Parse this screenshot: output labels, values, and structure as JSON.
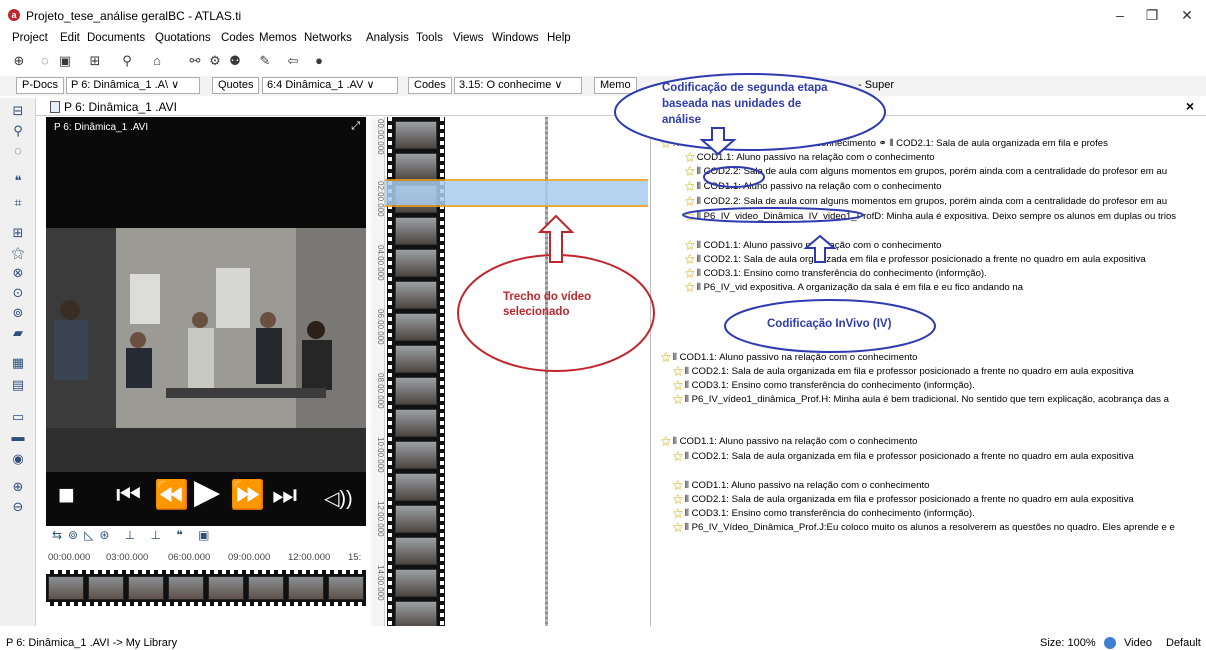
{
  "window": {
    "title": "Projeto_tese_análise geralBC - ATLAS.ti",
    "minimize": "–",
    "maximize": "❐",
    "close": "✕"
  },
  "menu": [
    "Project",
    "Edit",
    "Documents",
    "Quotations",
    "Codes",
    "Memos",
    "Networks",
    "Analysis",
    "Tools",
    "Views",
    "Windows",
    "Help"
  ],
  "toolbar2": {
    "pdocs_button": "P-Docs",
    "pdoc_select": "P 6: Dinâmica_1 .A\\ ∨",
    "quotes_button": "Quotes",
    "quote_select": "6:4 Dinâmica_1 .AV ∨",
    "codes_button": "Codes",
    "code_select": "3.15: O conhecime ∨",
    "memos_button": "Memo",
    "memo_select": "- Super"
  },
  "document": {
    "header_title": "P 6: Dinâmica_1 .AVI",
    "close_label": "×"
  },
  "video": {
    "label": "P 6: Dinâmica_1 .AVI",
    "timeline_ticks": [
      "00:00.000",
      "03:00.000",
      "06:00.000",
      "09:00.000",
      "12:00.000",
      "15:"
    ]
  },
  "vertical_ticks": [
    "00:00.000",
    "02:00.000",
    "04:00.000",
    "06:00.000",
    "08:00.000",
    "10:00.000",
    "12:00.000",
    "14:00.000"
  ],
  "codes": [
    {
      "text": ": Aluno passivo na relação com o conhecimento  ⚭ ⦀ COD2.1: Sala de aula organizada em fila e profes"
    },
    {
      "text": "COD1.1: Aluno passivo na relação com o conhecimento"
    },
    {
      "text": "⦀ COD2.2: Sala de aula com alguns momentos em grupos, porém ainda com a centralidade do profesor em au"
    },
    {
      "text": "⦀ COD1.1: Aluno passivo na relação com o conhecimento"
    },
    {
      "text": "⦀ COD2.2: Sala de aula com alguns momentos em grupos, porém ainda com a centralidade do profesor em au"
    },
    {
      "text": "⦀ P6_IV_video_Dinâmica_IV_video1_ProfD: Minha aula é expositiva. Deixo sempre os alunos em duplas ou trios"
    },
    {
      "text": "⦀ COD1.1: Aluno passivo na relação com o conhecimento"
    },
    {
      "text": "⦀ COD2.1: Sala de aula organizada em fila e professor posicionado a frente no quadro em aula expositiva"
    },
    {
      "text": "⦀ COD3.1: Ensino como transferência do conhecimento (informção)."
    },
    {
      "text": "⦀ P6_IV_vid  expositiva. A organização da sala é em fila e eu fico andando na"
    },
    {
      "text": "⦀ COD1.1: Aluno passivo na relação com o conhecimento"
    },
    {
      "text": "⦀ COD2.1: Sala de aula organizada em fila e professor posicionado a frente no quadro em aula expositiva"
    },
    {
      "text": "⦀ COD3.1: Ensino como transferência do conhecimento (informção)."
    },
    {
      "text": "⦀ P6_IV_vídeo1_dinâmica_Prof.H: Minha aula é bem tradicional. No sentido que tem explicação, acobrança das a"
    },
    {
      "text": "⦀ COD1.1: Aluno passivo na relação com o conhecimento"
    },
    {
      "text": "⦀ COD2.1: Sala de aula organizada em fila e professor posicionado a frente no quadro em aula expositiva"
    },
    {
      "text": "⦀ COD1.1: Aluno passivo na relação com o conhecimento"
    },
    {
      "text": "⦀ COD2.1: Sala de aula organizada em fila e professor posicionado a frente no quadro em aula expositiva"
    },
    {
      "text": "⦀ COD3.1: Ensino como transferência do conhecimento (informção)."
    },
    {
      "text": "⦀ P6_IV_Vídeo_Dinâmica_Prof.J:Eu coloco muito os alunos a resolverem as questões no quadro. Eles aprende e e"
    }
  ],
  "annotations": {
    "top": "Codificação de segunda etapa baseada nas unidades de análise",
    "selection": "Trecho do vídeo selecionado",
    "invivo": "Codificação InVivo (IV)",
    "colors": {
      "blue": "#2e3bb0",
      "red": "#c0272d"
    }
  },
  "status": {
    "left": "P 6: Dinâmica_1 .AVI -> My Library",
    "size": "Size: 100%",
    "video": "Video",
    "default": "Default"
  }
}
